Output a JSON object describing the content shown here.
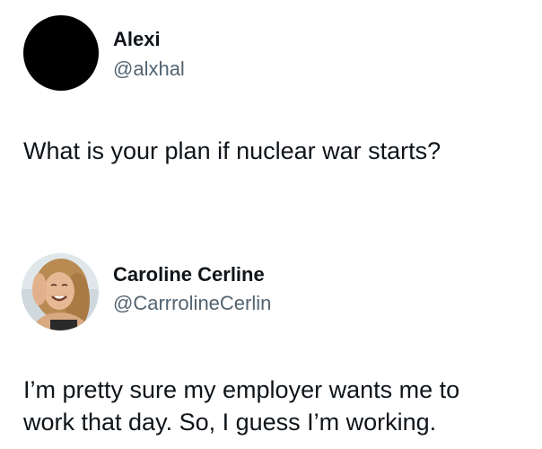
{
  "tweets": [
    {
      "author": {
        "name": "Alexi",
        "handle": "@alxhal",
        "avatar_color": "#000000"
      },
      "text": "What is your plan if nuclear war starts?"
    },
    {
      "author": {
        "name": "Caroline Cerline",
        "handle": "@CarrrolineCerlin",
        "avatar": "profile-photo"
      },
      "text_lines": [
        "I’m pretty sure my employer wants me to",
        "work that day. So, I guess I’m working."
      ]
    }
  ],
  "colors": {
    "text": "#0f1419",
    "secondary_text": "#536471",
    "background": "#ffffff"
  }
}
